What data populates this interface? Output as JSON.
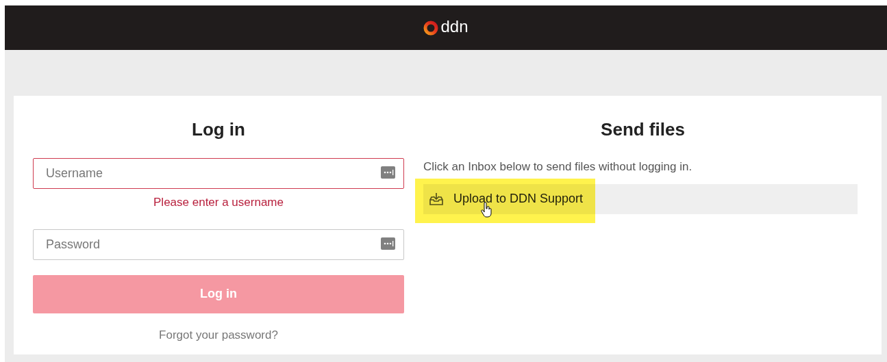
{
  "header": {
    "logo": "ddn"
  },
  "login": {
    "title": "Log in",
    "fields": [
      {
        "placeholder": "Username",
        "invalid": true,
        "error": "Please enter a username"
      },
      {
        "placeholder": "Password",
        "invalid": false
      }
    ],
    "submit": {
      "label": "Log in",
      "disabled": true
    },
    "forgot_link": "Forgot your password?"
  },
  "send_files": {
    "title": "Send files",
    "intro": "Click an Inbox below to send files without logging in.",
    "inboxes": [
      {
        "label": "Upload to DDN Support",
        "highlighted": true
      }
    ]
  }
}
